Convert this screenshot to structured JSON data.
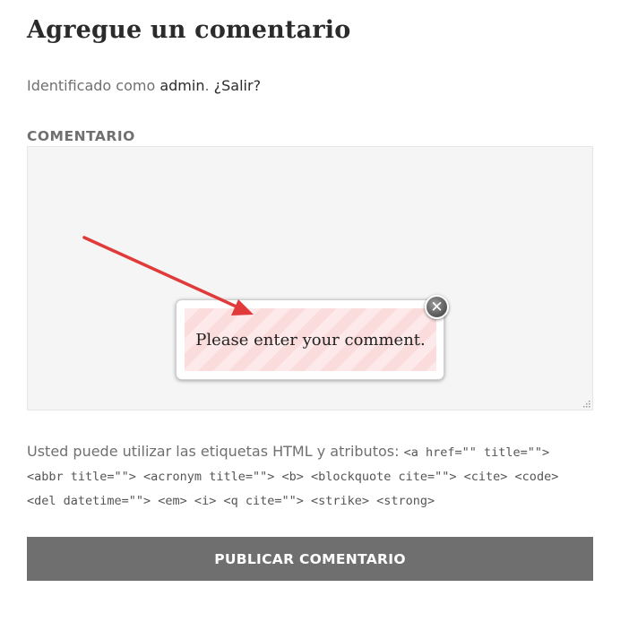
{
  "form": {
    "title": "Agregue un comentario",
    "logged_prefix": "Identificado como ",
    "user_link": "admin",
    "logged_sep": ". ",
    "logout_link": "¿Salir?",
    "comment_label": "COMENTARIO",
    "comment_value": "",
    "allowed_prefix": "Usted puede utilizar las etiquetas HTML y atributos: ",
    "allowed_tags": "<a href=\"\" title=\"\"> <abbr title=\"\"> <acronym title=\"\"> <b> <blockquote cite=\"\"> <cite> <code> <del datetime=\"\"> <em> <i> <q cite=\"\"> <strike> <strong>",
    "submit_label": "PUBLICAR COMENTARIO"
  },
  "validation_popup": {
    "message": "Please enter your comment.",
    "close_icon": "close-icon"
  },
  "annotation": {
    "arrow_color": "#e03a3a",
    "icon": "arrow-pointer"
  },
  "colors": {
    "button_bg": "#6f6f6f",
    "textarea_bg": "#f5f5f5",
    "popup_stripe_a": "#fde9e9",
    "popup_stripe_b": "#fbdcdc"
  }
}
